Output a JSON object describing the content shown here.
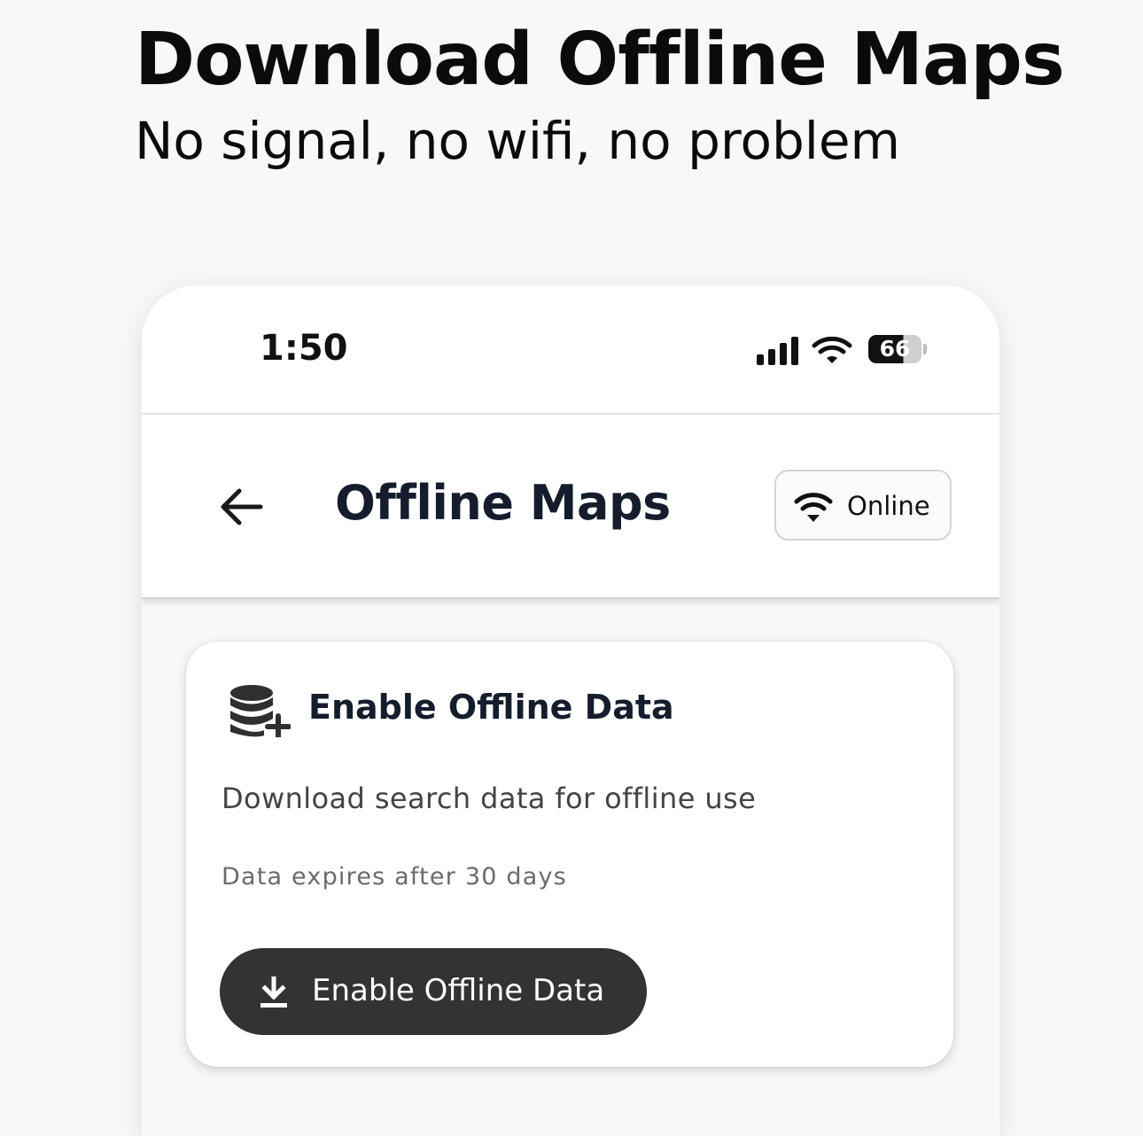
{
  "promo": {
    "headline": "Download Offline Maps",
    "subheadline": "No signal, no wifi, no problem"
  },
  "status_bar": {
    "time": "1:50",
    "battery_percent": "66",
    "icons": [
      "cellular-signal-icon",
      "wifi-icon",
      "battery-icon"
    ]
  },
  "header": {
    "title": "Offline Maps",
    "back_icon": "arrow-left-icon",
    "connection": {
      "icon": "wifi-icon",
      "label": "Online"
    }
  },
  "offline_card": {
    "icon": "database-add-icon",
    "title": "Enable Offline Data",
    "description": "Download search data for offline use",
    "note": "Data expires after 30 days",
    "button": {
      "icon": "download-icon",
      "label": "Enable Offline Data"
    }
  },
  "colors": {
    "page_background": "#f8f8f8",
    "surface": "#ffffff",
    "title_text": "#151c2c",
    "button_background": "#333333",
    "button_text": "#ffffff"
  }
}
